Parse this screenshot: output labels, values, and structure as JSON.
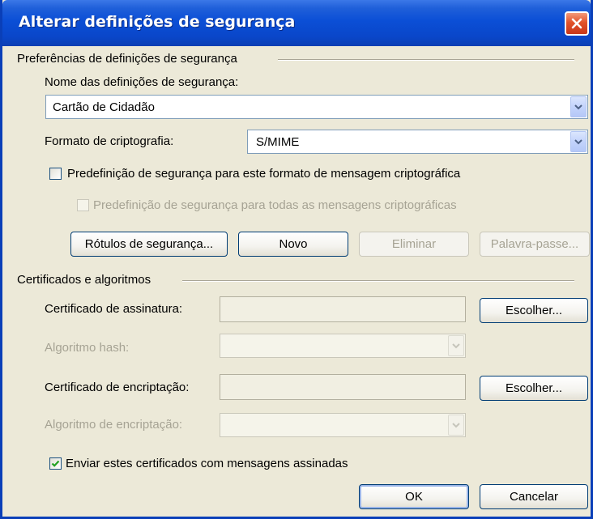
{
  "window": {
    "title": "Alterar definições de segurança"
  },
  "preferences": {
    "group_label": "Preferências de definições de segurança",
    "name_label": "Nome das definições de segurança:",
    "name_value": "Cartão de Cidadão",
    "format_label": "Formato de criptografia:",
    "format_value": "S/MIME",
    "default_for_format_label": "Predefinição de segurança para este formato de mensagem criptográfica",
    "default_for_format_checked": false,
    "default_for_all_label": "Predefinição de segurança para todas as mensagens criptográficas",
    "default_for_all_checked": false,
    "buttons": {
      "labels": "Rótulos de segurança...",
      "new": "Novo",
      "delete": "Eliminar",
      "password": "Palavra-passe..."
    }
  },
  "certificates": {
    "group_label": "Certificados e algoritmos",
    "signing_cert_label": "Certificado de assinatura:",
    "signing_cert_value": "",
    "hash_alg_label": "Algoritmo hash:",
    "hash_alg_value": "",
    "encryption_cert_label": "Certificado de encriptação:",
    "encryption_cert_value": "",
    "encryption_alg_label": "Algoritmo de encriptação:",
    "encryption_alg_value": "",
    "choose_label": "Escolher...",
    "send_certs_label": "Enviar estes certificados com mensagens assinadas",
    "send_certs_checked": true
  },
  "footer": {
    "ok": "OK",
    "cancel": "Cancelar"
  },
  "colors": {
    "titlebar": "#0a46c9",
    "dialog_bg": "#ece9d8",
    "close_button": "#e2532b",
    "disabled_text": "#a6a394"
  }
}
